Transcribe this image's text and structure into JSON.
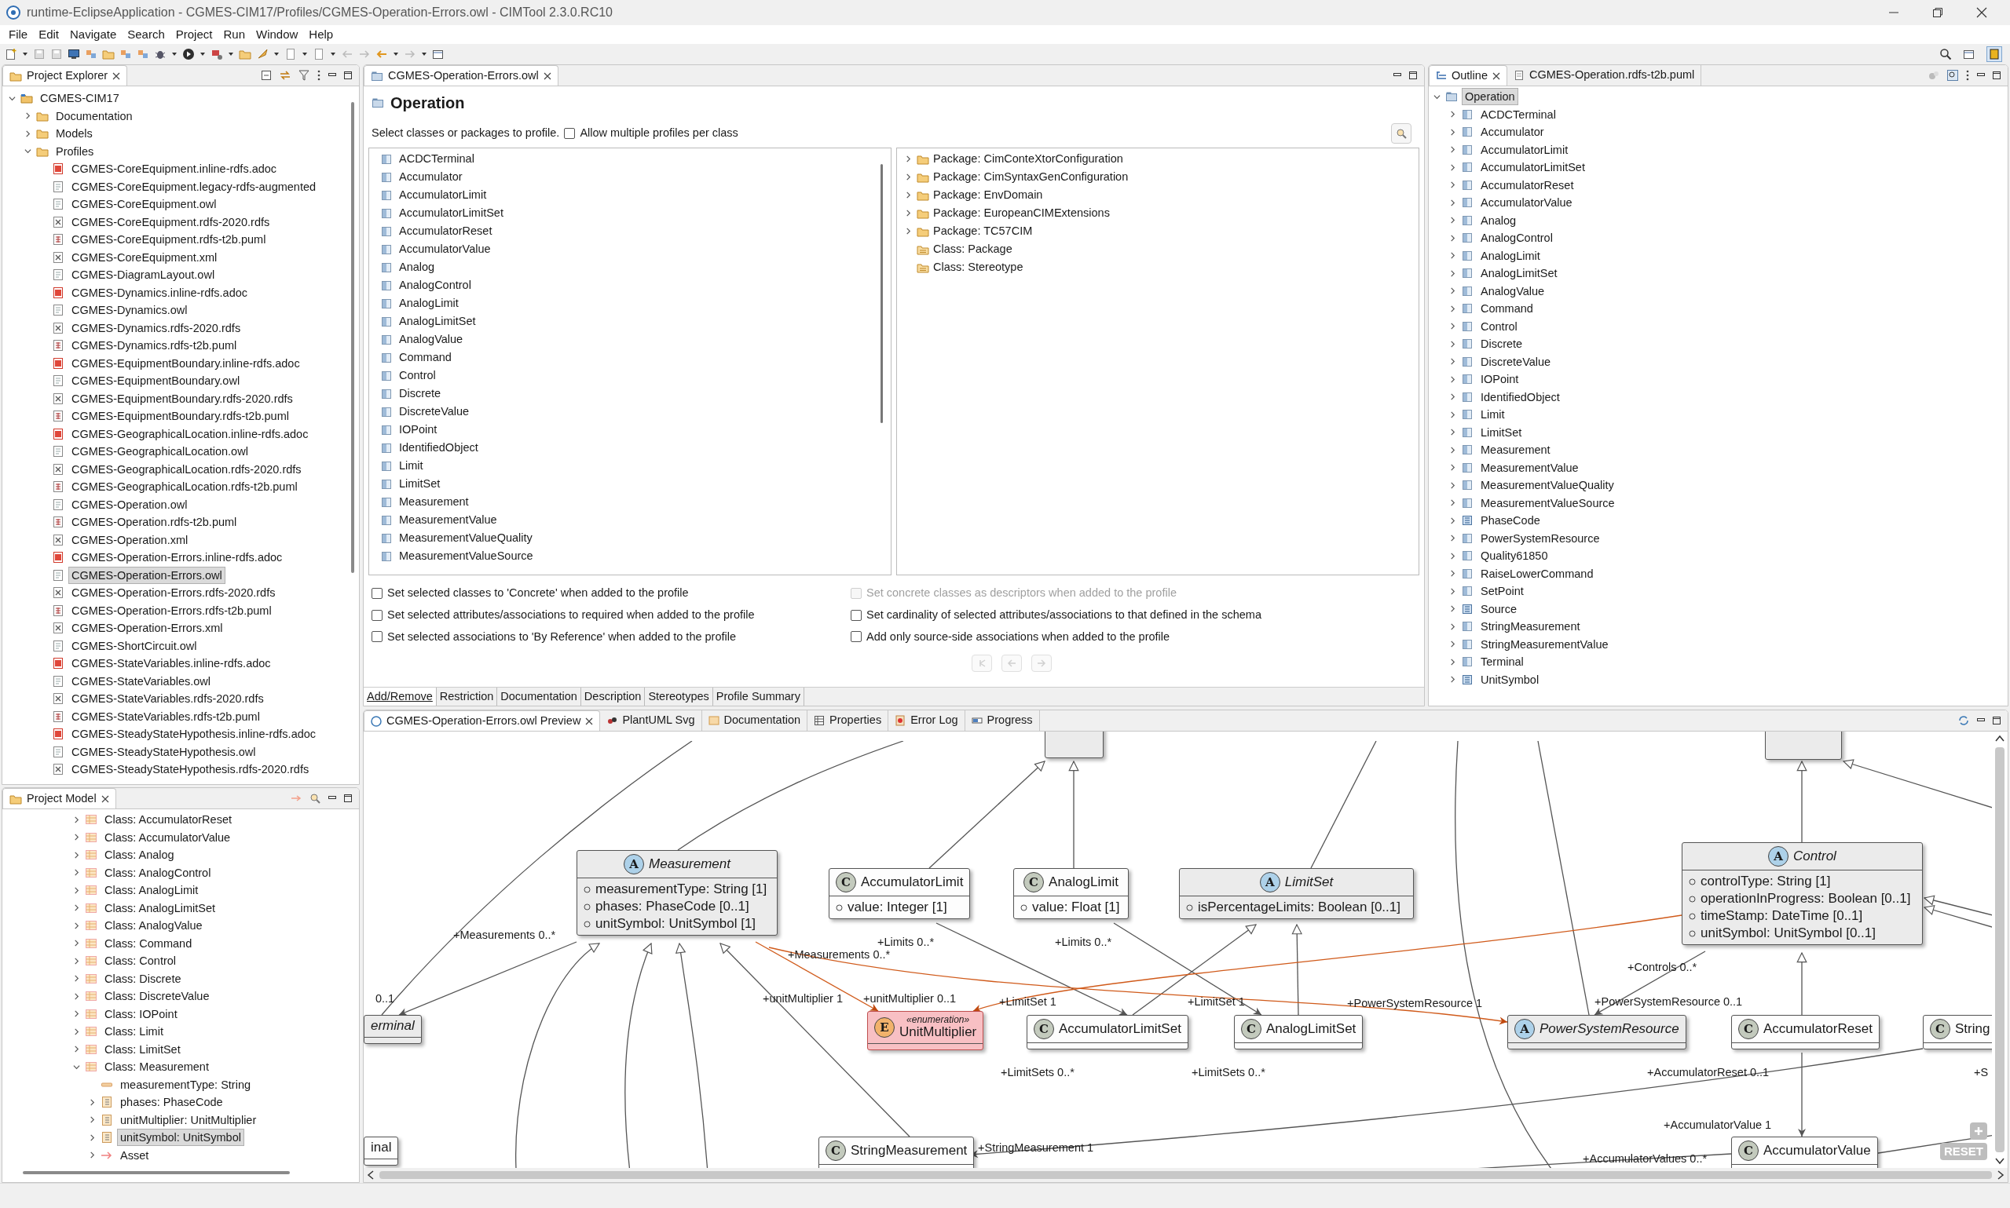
{
  "window": {
    "title": "runtime-EclipseApplication - CGMES-CIM17/Profiles/CGMES-Operation-Errors.owl - CIMTool 2.3.0.RC10"
  },
  "menu": [
    "File",
    "Edit",
    "Navigate",
    "Search",
    "Project",
    "Run",
    "Window",
    "Help"
  ],
  "project_explorer": {
    "title": "Project Explorer",
    "tree": [
      {
        "label": "CGMES-CIM17",
        "kind": "project",
        "expanded": true,
        "selected": false,
        "children": [
          {
            "label": "Documentation",
            "kind": "folder",
            "expanded": false,
            "selected": false
          },
          {
            "label": "Models",
            "kind": "folder",
            "expanded": false,
            "selected": false
          },
          {
            "label": "Profiles",
            "kind": "folder",
            "expanded": true,
            "selected": false,
            "children": [
              {
                "label": "CGMES-CoreEquipment.inline-rdfs.adoc",
                "kind": "adoc",
                "selected": false
              },
              {
                "label": "CGMES-CoreEquipment.legacy-rdfs-augmented",
                "kind": "text",
                "selected": false
              },
              {
                "label": "CGMES-CoreEquipment.owl",
                "kind": "owl",
                "selected": false
              },
              {
                "label": "CGMES-CoreEquipment.rdfs-2020.rdfs",
                "kind": "rdfs",
                "selected": false
              },
              {
                "label": "CGMES-CoreEquipment.rdfs-t2b.puml",
                "kind": "puml",
                "selected": false
              },
              {
                "label": "CGMES-CoreEquipment.xml",
                "kind": "xml",
                "selected": false
              },
              {
                "label": "CGMES-DiagramLayout.owl",
                "kind": "owl",
                "selected": false
              },
              {
                "label": "CGMES-Dynamics.inline-rdfs.adoc",
                "kind": "adoc",
                "selected": false
              },
              {
                "label": "CGMES-Dynamics.owl",
                "kind": "owl",
                "selected": false
              },
              {
                "label": "CGMES-Dynamics.rdfs-2020.rdfs",
                "kind": "rdfs",
                "selected": false
              },
              {
                "label": "CGMES-Dynamics.rdfs-t2b.puml",
                "kind": "puml",
                "selected": false
              },
              {
                "label": "CGMES-EquipmentBoundary.inline-rdfs.adoc",
                "kind": "adoc",
                "selected": false
              },
              {
                "label": "CGMES-EquipmentBoundary.owl",
                "kind": "owl",
                "selected": false
              },
              {
                "label": "CGMES-EquipmentBoundary.rdfs-2020.rdfs",
                "kind": "rdfs",
                "selected": false
              },
              {
                "label": "CGMES-EquipmentBoundary.rdfs-t2b.puml",
                "kind": "puml",
                "selected": false
              },
              {
                "label": "CGMES-GeographicalLocation.inline-rdfs.adoc",
                "kind": "adoc",
                "selected": false
              },
              {
                "label": "CGMES-GeographicalLocation.owl",
                "kind": "owl",
                "selected": false
              },
              {
                "label": "CGMES-GeographicalLocation.rdfs-2020.rdfs",
                "kind": "rdfs",
                "selected": false
              },
              {
                "label": "CGMES-GeographicalLocation.rdfs-t2b.puml",
                "kind": "puml",
                "selected": false
              },
              {
                "label": "CGMES-Operation.owl",
                "kind": "owl",
                "selected": false
              },
              {
                "label": "CGMES-Operation.rdfs-t2b.puml",
                "kind": "puml",
                "selected": false
              },
              {
                "label": "CGMES-Operation.xml",
                "kind": "xml",
                "selected": false
              },
              {
                "label": "CGMES-Operation-Errors.inline-rdfs.adoc",
                "kind": "adoc",
                "selected": false
              },
              {
                "label": "CGMES-Operation-Errors.owl",
                "kind": "owl",
                "selected": true
              },
              {
                "label": "CGMES-Operation-Errors.rdfs-2020.rdfs",
                "kind": "rdfs",
                "selected": false
              },
              {
                "label": "CGMES-Operation-Errors.rdfs-t2b.puml",
                "kind": "puml",
                "selected": false
              },
              {
                "label": "CGMES-Operation-Errors.xml",
                "kind": "xml",
                "selected": false
              },
              {
                "label": "CGMES-ShortCircuit.owl",
                "kind": "owl",
                "selected": false
              },
              {
                "label": "CGMES-StateVariables.inline-rdfs.adoc",
                "kind": "adoc",
                "selected": false
              },
              {
                "label": "CGMES-StateVariables.owl",
                "kind": "owl",
                "selected": false
              },
              {
                "label": "CGMES-StateVariables.rdfs-2020.rdfs",
                "kind": "rdfs",
                "selected": false
              },
              {
                "label": "CGMES-StateVariables.rdfs-t2b.puml",
                "kind": "puml",
                "selected": false
              },
              {
                "label": "CGMES-SteadyStateHypothesis.inline-rdfs.adoc",
                "kind": "adoc",
                "selected": false
              },
              {
                "label": "CGMES-SteadyStateHypothesis.owl",
                "kind": "owl",
                "selected": false
              },
              {
                "label": "CGMES-SteadyStateHypothesis.rdfs-2020.rdfs",
                "kind": "rdfs",
                "selected": false
              }
            ]
          }
        ]
      }
    ]
  },
  "project_model": {
    "title": "Project Model",
    "tree": [
      {
        "label": "Class: AccumulatorReset",
        "kind": "class",
        "expanded": false,
        "selected": false
      },
      {
        "label": "Class: AccumulatorValue",
        "kind": "class",
        "expanded": false,
        "selected": false
      },
      {
        "label": "Class: Analog",
        "kind": "class",
        "expanded": false,
        "selected": false
      },
      {
        "label": "Class: AnalogControl",
        "kind": "class",
        "expanded": false,
        "selected": false
      },
      {
        "label": "Class: AnalogLimit",
        "kind": "class",
        "expanded": false,
        "selected": false
      },
      {
        "label": "Class: AnalogLimitSet",
        "kind": "class",
        "expanded": false,
        "selected": false
      },
      {
        "label": "Class: AnalogValue",
        "kind": "class",
        "expanded": false,
        "selected": false
      },
      {
        "label": "Class: Command",
        "kind": "class",
        "expanded": false,
        "selected": false
      },
      {
        "label": "Class: Control",
        "kind": "class",
        "expanded": false,
        "selected": false
      },
      {
        "label": "Class: Discrete",
        "kind": "class",
        "expanded": false,
        "selected": false
      },
      {
        "label": "Class: DiscreteValue",
        "kind": "class",
        "expanded": false,
        "selected": false
      },
      {
        "label": "Class: IOPoint",
        "kind": "class",
        "expanded": false,
        "selected": false
      },
      {
        "label": "Class: Limit",
        "kind": "class",
        "expanded": false,
        "selected": false
      },
      {
        "label": "Class: LimitSet",
        "kind": "class",
        "expanded": false,
        "selected": false
      },
      {
        "label": "Class: Measurement",
        "kind": "class",
        "expanded": true,
        "selected": false,
        "children": [
          {
            "label": "measurementType: String",
            "kind": "attribute",
            "selected": false
          },
          {
            "label": "phases: PhaseCode",
            "kind": "attribute-list",
            "expanded": false,
            "selected": false
          },
          {
            "label": "unitMultiplier: UnitMultiplier",
            "kind": "attribute-list",
            "expanded": false,
            "selected": false
          },
          {
            "label": "unitSymbol: UnitSymbol",
            "kind": "attribute-list",
            "expanded": false,
            "selected": true
          },
          {
            "label": "Asset",
            "kind": "association",
            "expanded": false,
            "selected": false
          }
        ]
      }
    ]
  },
  "editor": {
    "tab": "CGMES-Operation-Errors.owl",
    "heading": "Operation",
    "instruction": "Select classes or packages to profile.",
    "allow_multiple": {
      "label": "Allow multiple profiles per class",
      "checked": false
    },
    "classes": [
      {
        "label": "ACDCTerminal",
        "selected": false
      },
      {
        "label": "Accumulator",
        "selected": false
      },
      {
        "label": "AccumulatorLimit",
        "selected": false
      },
      {
        "label": "AccumulatorLimitSet",
        "selected": false
      },
      {
        "label": "AccumulatorReset",
        "selected": false
      },
      {
        "label": "AccumulatorValue",
        "selected": false
      },
      {
        "label": "Analog",
        "selected": false
      },
      {
        "label": "AnalogControl",
        "selected": false
      },
      {
        "label": "AnalogLimit",
        "selected": false
      },
      {
        "label": "AnalogLimitSet",
        "selected": false
      },
      {
        "label": "AnalogValue",
        "selected": false
      },
      {
        "label": "Command",
        "selected": false
      },
      {
        "label": "Control",
        "selected": false
      },
      {
        "label": "Discrete",
        "selected": false
      },
      {
        "label": "DiscreteValue",
        "selected": false
      },
      {
        "label": "IOPoint",
        "selected": false
      },
      {
        "label": "IdentifiedObject",
        "selected": false
      },
      {
        "label": "Limit",
        "selected": false
      },
      {
        "label": "LimitSet",
        "selected": false
      },
      {
        "label": "Measurement",
        "selected": false
      },
      {
        "label": "MeasurementValue",
        "selected": false
      },
      {
        "label": "MeasurementValueQuality",
        "selected": false
      },
      {
        "label": "MeasurementValueSource",
        "selected": false
      }
    ],
    "packages": [
      {
        "label": "Package: CimConteXtorConfiguration",
        "kind": "package",
        "expanded": false
      },
      {
        "label": "Package: CimSyntaxGenConfiguration",
        "kind": "package",
        "expanded": false
      },
      {
        "label": "Package: EnvDomain",
        "kind": "package",
        "expanded": false
      },
      {
        "label": "Package: EuropeanCIMExtensions",
        "kind": "package",
        "expanded": false
      },
      {
        "label": "Package: TC57CIM",
        "kind": "package",
        "expanded": false
      },
      {
        "label": "Class: Package",
        "kind": "class"
      },
      {
        "label": "Class: Stereotype",
        "kind": "class"
      }
    ],
    "options": [
      {
        "label": "Set selected classes to 'Concrete' when added to the profile",
        "checked": false,
        "disabled": false
      },
      {
        "label": "Set concrete classes as descriptors when added to the profile",
        "checked": false,
        "disabled": true
      },
      {
        "label": "Set selected attributes/associations to required when added to the profile",
        "checked": false,
        "disabled": false
      },
      {
        "label": "Set cardinality of selected attributes/associations to that defined in the schema",
        "checked": false,
        "disabled": false
      },
      {
        "label": "Set selected associations to 'By Reference' when added to the profile",
        "checked": false,
        "disabled": false
      },
      {
        "label": "Add only source-side associations when added to the profile",
        "checked": false,
        "disabled": false
      }
    ],
    "nav_buttons": [
      {
        "kind": "first",
        "disabled": true
      },
      {
        "kind": "back",
        "disabled": true
      },
      {
        "kind": "forward",
        "disabled": true
      }
    ],
    "tabs": [
      {
        "label": "Add/Remove",
        "selected": true
      },
      {
        "label": "Restriction",
        "selected": false
      },
      {
        "label": "Documentation",
        "selected": false
      },
      {
        "label": "Description",
        "selected": false
      },
      {
        "label": "Stereotypes",
        "selected": false
      },
      {
        "label": "Profile Summary",
        "selected": false
      }
    ]
  },
  "outline": {
    "tabs": [
      {
        "label": "Outline",
        "kind": "outline",
        "selected": true
      },
      {
        "label": "CGMES-Operation.rdfs-t2b.puml",
        "kind": "file",
        "selected": false
      }
    ],
    "tree": [
      {
        "label": "Operation",
        "kind": "package",
        "expanded": true,
        "selected": true,
        "children": [
          {
            "label": "ACDCTerminal",
            "kind": "class",
            "expanded": false
          },
          {
            "label": "Accumulator",
            "kind": "class",
            "expanded": false
          },
          {
            "label": "AccumulatorLimit",
            "kind": "class",
            "expanded": false
          },
          {
            "label": "AccumulatorLimitSet",
            "kind": "class",
            "expanded": false
          },
          {
            "label": "AccumulatorReset",
            "kind": "class",
            "expanded": false
          },
          {
            "label": "AccumulatorValue",
            "kind": "class",
            "expanded": false
          },
          {
            "label": "Analog",
            "kind": "class",
            "expanded": false
          },
          {
            "label": "AnalogControl",
            "kind": "class",
            "expanded": false
          },
          {
            "label": "AnalogLimit",
            "kind": "class",
            "expanded": false
          },
          {
            "label": "AnalogLimitSet",
            "kind": "class",
            "expanded": false
          },
          {
            "label": "AnalogValue",
            "kind": "class",
            "expanded": false
          },
          {
            "label": "Command",
            "kind": "class",
            "expanded": false
          },
          {
            "label": "Control",
            "kind": "class",
            "expanded": false
          },
          {
            "label": "Discrete",
            "kind": "class",
            "expanded": false
          },
          {
            "label": "DiscreteValue",
            "kind": "class",
            "expanded": false
          },
          {
            "label": "IOPoint",
            "kind": "class",
            "expanded": false
          },
          {
            "label": "IdentifiedObject",
            "kind": "class",
            "expanded": false
          },
          {
            "label": "Limit",
            "kind": "class",
            "expanded": false
          },
          {
            "label": "LimitSet",
            "kind": "class",
            "expanded": false
          },
          {
            "label": "Measurement",
            "kind": "class",
            "expanded": false
          },
          {
            "label": "MeasurementValue",
            "kind": "class",
            "expanded": false
          },
          {
            "label": "MeasurementValueQuality",
            "kind": "class",
            "expanded": false
          },
          {
            "label": "MeasurementValueSource",
            "kind": "class",
            "expanded": false
          },
          {
            "label": "PhaseCode",
            "kind": "enum",
            "expanded": false
          },
          {
            "label": "PowerSystemResource",
            "kind": "class",
            "expanded": false
          },
          {
            "label": "Quality61850",
            "kind": "class",
            "expanded": false
          },
          {
            "label": "RaiseLowerCommand",
            "kind": "class",
            "expanded": false
          },
          {
            "label": "SetPoint",
            "kind": "class",
            "expanded": false
          },
          {
            "label": "Source",
            "kind": "enum",
            "expanded": false
          },
          {
            "label": "StringMeasurement",
            "kind": "class",
            "expanded": false
          },
          {
            "label": "StringMeasurementValue",
            "kind": "class",
            "expanded": false
          },
          {
            "label": "Terminal",
            "kind": "class",
            "expanded": false
          },
          {
            "label": "UnitSymbol",
            "kind": "enum",
            "expanded": false
          }
        ]
      }
    ]
  },
  "preview": {
    "tabs": [
      {
        "label": "CGMES-Operation-Errors.owl Preview",
        "kind": "preview",
        "selected": true
      },
      {
        "label": "PlantUML Svg",
        "kind": "plantuml",
        "selected": false
      },
      {
        "label": "Documentation",
        "kind": "documentation",
        "selected": false
      },
      {
        "label": "Properties",
        "kind": "properties",
        "selected": false
      },
      {
        "label": "Error Log",
        "kind": "errorlog",
        "selected": false
      },
      {
        "label": "Progress",
        "kind": "progress",
        "selected": false
      }
    ],
    "nodes": [
      {
        "badge": "A",
        "kind": "abstract",
        "name": "Measurement",
        "error": false,
        "attributes": [
          "measurementType: String [1]",
          "phases: PhaseCode [0..1]",
          "unitSymbol: UnitSymbol [1]"
        ]
      },
      {
        "badge": "C",
        "kind": "class",
        "name": "AccumulatorLimit",
        "error": false,
        "attributes": [
          "value: Integer [1]"
        ]
      },
      {
        "badge": "C",
        "kind": "class",
        "name": "AnalogLimit",
        "error": false,
        "attributes": [
          "value: Float [1]"
        ]
      },
      {
        "badge": "A",
        "kind": "abstract",
        "name": "LimitSet",
        "error": false,
        "attributes": [
          "isPercentageLimits: Boolean [0..1]"
        ]
      },
      {
        "badge": "A",
        "kind": "abstract",
        "name": "Control",
        "error": false,
        "attributes": [
          "controlType: String [1]",
          "operationInProgress: Boolean [0..1]",
          "timeStamp: DateTime [0..1]",
          "unitSymbol: UnitSymbol [0..1]"
        ]
      },
      {
        "kind": "abstract",
        "name": "erminal",
        "error": false
      },
      {
        "badge": "E",
        "kind": "enumeration",
        "stereotype": "«enumeration»",
        "name": "UnitMultiplier",
        "error": true
      },
      {
        "badge": "C",
        "kind": "class",
        "name": "AccumulatorLimitSet",
        "error": false
      },
      {
        "badge": "C",
        "kind": "class",
        "name": "AnalogLimitSet",
        "error": false
      },
      {
        "badge": "A",
        "kind": "abstract",
        "name": "PowerSystemResource",
        "error": false
      },
      {
        "badge": "C",
        "kind": "class",
        "name": "AccumulatorReset",
        "error": false
      },
      {
        "badge": "C",
        "kind": "class",
        "name": "String",
        "error": false
      },
      {
        "kind": "class",
        "name": "inal",
        "error": false
      },
      {
        "badge": "C",
        "kind": "class",
        "name": "StringMeasurement",
        "error": false
      },
      {
        "badge": "C",
        "kind": "class",
        "name": "AccumulatorValue",
        "error": false
      }
    ],
    "edge_labels": [
      "+Measurements 0..*",
      "+Limits 0..*",
      "+Limits 0..*",
      "+Measurements 0..*",
      "+Controls 0..*",
      "0..1",
      "+unitMultiplier 1",
      "+unitMultiplier 0..1",
      "+LimitSet 1",
      "+LimitSet 1",
      "+PowerSystemResource 1",
      "+PowerSystemResource 0..1",
      "+LimitSets 0..*",
      "+LimitSets 0..*",
      "+AccumulatorReset 0..1",
      "+S",
      "+AccumulatorValue 1",
      "+StringMeasurement 1",
      "+AccumulatorValues 0..*"
    ],
    "reset_button": "RESET"
  }
}
